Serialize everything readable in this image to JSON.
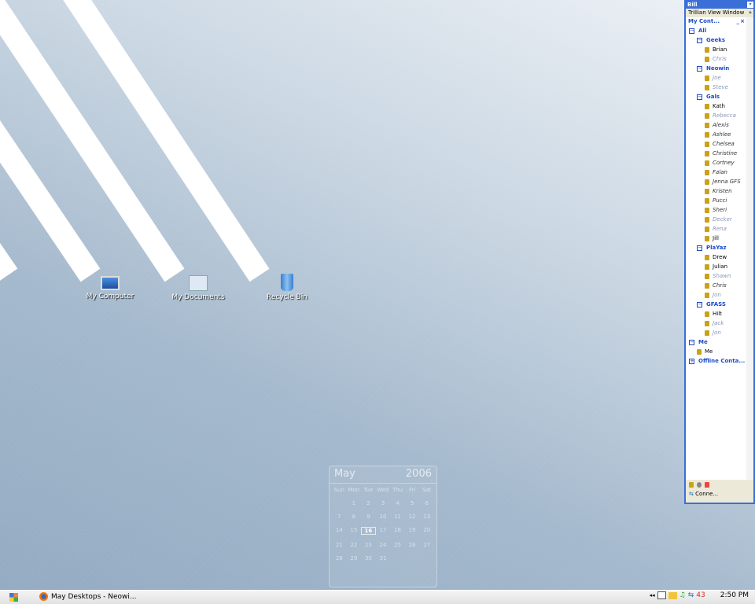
{
  "desktop": {
    "icons": [
      {
        "label": "My Computer"
      },
      {
        "label": "My Documents"
      },
      {
        "label": "Recycle Bin"
      }
    ]
  },
  "calendar": {
    "month": "May",
    "year": "2006",
    "days": [
      "Sun",
      "Mon",
      "Tue",
      "Wed",
      "Thu",
      "Fri",
      "Sat"
    ],
    "today": "16",
    "dates": [
      "",
      "1",
      "2",
      "3",
      "4",
      "5",
      "6",
      "7",
      "8",
      "9",
      "10",
      "11",
      "12",
      "13",
      "14",
      "15",
      "16",
      "17",
      "18",
      "19",
      "20",
      "21",
      "22",
      "23",
      "24",
      "25",
      "26",
      "27",
      "28",
      "29",
      "30",
      "31"
    ]
  },
  "trillian": {
    "title": "Bill",
    "view_window": "Trillian View Window",
    "list_header": "My Cont...",
    "status": "Conne...",
    "rows": [
      {
        "t": "g0",
        "l": "All",
        "s": "grp",
        "lvl": 0
      },
      {
        "t": "g",
        "l": "Geeks",
        "s": "grp",
        "lvl": 1
      },
      {
        "l": "Brian",
        "s": "on"
      },
      {
        "l": "Chris",
        "s": "off"
      },
      {
        "t": "g",
        "l": "Neowin",
        "s": "grp",
        "lvl": 1
      },
      {
        "l": "Joe",
        "s": "off"
      },
      {
        "l": "Steve",
        "s": "off"
      },
      {
        "t": "g",
        "l": "Gals",
        "s": "grp",
        "lvl": 1
      },
      {
        "l": "Kath",
        "s": "on"
      },
      {
        "l": "Rebecca",
        "s": "off"
      },
      {
        "l": "Alexis",
        "s": "away"
      },
      {
        "l": "Ashlee",
        "s": "away"
      },
      {
        "l": "Chelsea",
        "s": "away"
      },
      {
        "l": "Christine",
        "s": "away"
      },
      {
        "l": "Cortney",
        "s": "away"
      },
      {
        "l": "Falan",
        "s": "away"
      },
      {
        "l": "Jenna GFS",
        "s": "away"
      },
      {
        "l": "Kristen",
        "s": "away"
      },
      {
        "l": "Pucci",
        "s": "away"
      },
      {
        "l": "Sheri",
        "s": "away"
      },
      {
        "l": "Decker",
        "s": "off"
      },
      {
        "l": "Rena",
        "s": "off"
      },
      {
        "l": "Jill",
        "s": "on"
      },
      {
        "t": "g",
        "l": "PlaYaz",
        "s": "grp",
        "lvl": 1
      },
      {
        "l": "Drew",
        "s": "on"
      },
      {
        "l": "Julian",
        "s": "on"
      },
      {
        "l": "Shawn",
        "s": "off"
      },
      {
        "l": "Chris",
        "s": "away"
      },
      {
        "l": "Jon",
        "s": "off"
      },
      {
        "t": "g",
        "l": "GFASS",
        "s": "grp",
        "lvl": 1
      },
      {
        "l": "Hilt",
        "s": "on"
      },
      {
        "l": "Jack",
        "s": "off"
      },
      {
        "l": "Jon",
        "s": "off"
      },
      {
        "t": "g0",
        "l": "Me",
        "s": "grp",
        "lvl": 0
      },
      {
        "l": "Me",
        "s": "on",
        "lvl": 1
      },
      {
        "t": "g0p",
        "l": "Offline Conta...",
        "s": "grp",
        "lvl": 0
      }
    ]
  },
  "taskbar": {
    "task": "May Desktops - Neowi...",
    "tray_count": "43",
    "clock": "2:50 PM"
  }
}
